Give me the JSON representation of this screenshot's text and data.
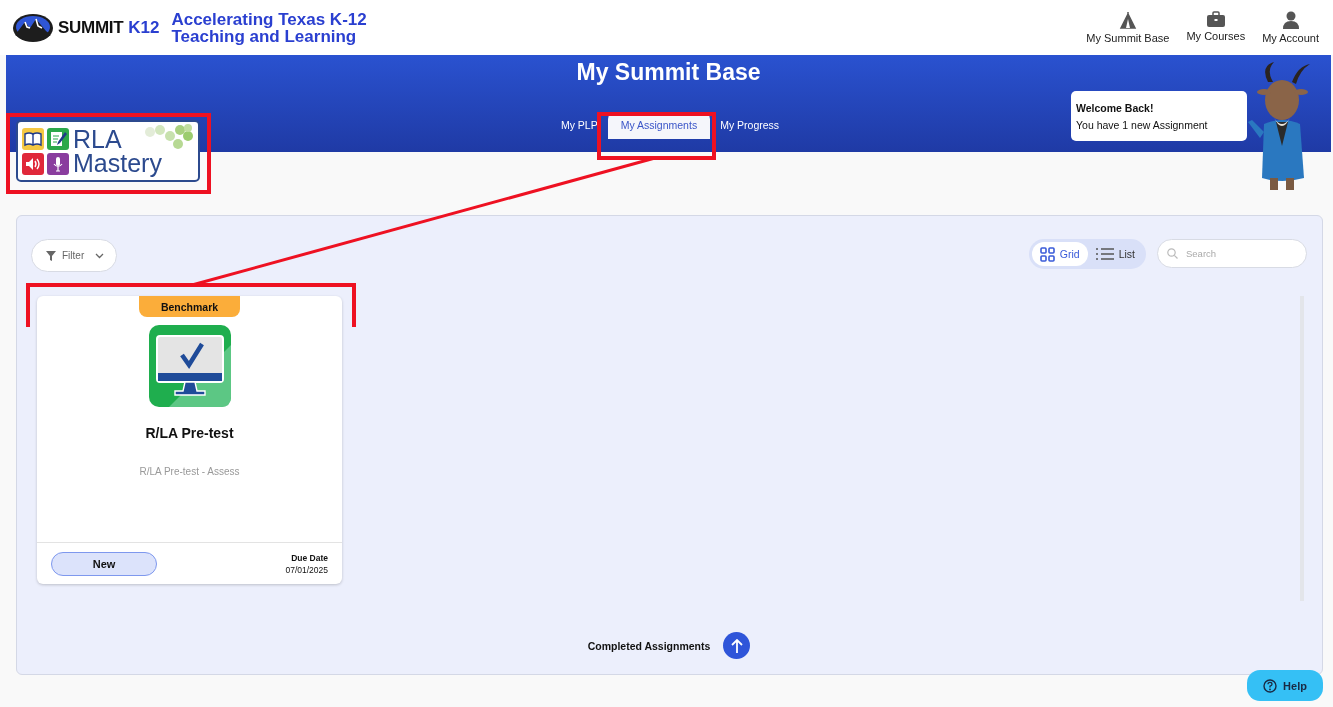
{
  "header": {
    "brand": "SUMMIT",
    "brand_suffix": "K12",
    "tagline": [
      "Accelerating Texas K-12",
      "Teaching and Learning"
    ],
    "nav": [
      {
        "label": "My Summit Base"
      },
      {
        "label": "My Courses"
      },
      {
        "label": "My Account"
      }
    ]
  },
  "banner": {
    "title": "My Summit Base",
    "tabs": [
      {
        "label": "My PLP",
        "selected": false
      },
      {
        "label": "My Assignments",
        "selected": true
      },
      {
        "label": "My Progress",
        "selected": false
      }
    ],
    "logo": {
      "lines": [
        "RLA",
        "Mastery"
      ]
    },
    "welcome": {
      "title": "Welcome Back!",
      "text": "You have 1 new Assignment"
    }
  },
  "toolbar": {
    "filter": "Filter",
    "views": [
      {
        "label": "Grid",
        "selected": true
      },
      {
        "label": "List",
        "selected": false
      }
    ],
    "search": {
      "placeholder": "Search"
    }
  },
  "assignments": [
    {
      "badge": "Benchmark",
      "title": "R/LA Pre-test",
      "subtitle": "R/LA Pre-test - Assess",
      "status": "New",
      "due_label": "Due Date",
      "due_date": "07/01/2025"
    }
  ],
  "completed": {
    "label": "Completed Assignments"
  },
  "help": {
    "label": "Help"
  }
}
